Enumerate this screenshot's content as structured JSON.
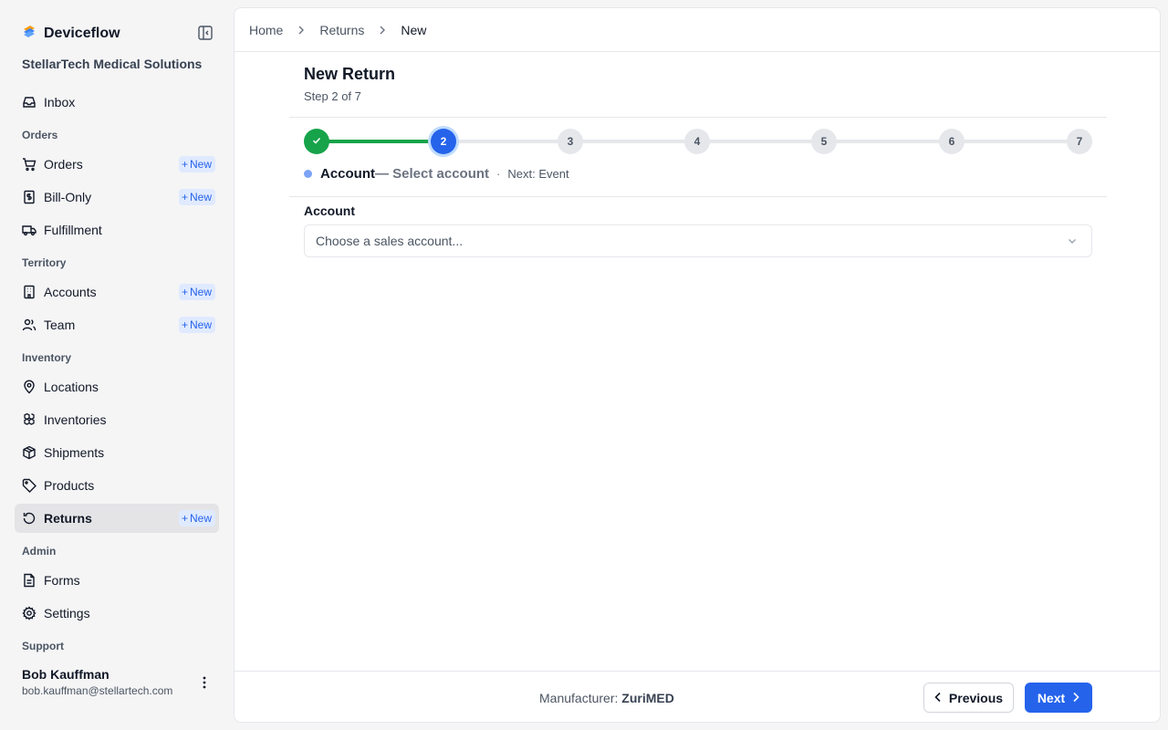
{
  "app": {
    "name": "Deviceflow",
    "org": "StellarTech Medical Solutions"
  },
  "sidebar": {
    "inbox": "Inbox",
    "sections": {
      "orders": "Orders",
      "territory": "Territory",
      "inventory": "Inventory",
      "admin": "Admin",
      "support": "Support"
    },
    "items": {
      "orders": "Orders",
      "bill_only": "Bill-Only",
      "fulfillment": "Fulfillment",
      "accounts": "Accounts",
      "team": "Team",
      "locations": "Locations",
      "inventories": "Inventories",
      "shipments": "Shipments",
      "products": "Products",
      "returns": "Returns",
      "forms": "Forms",
      "settings": "Settings"
    },
    "new_label": "New",
    "active_item": "Returns"
  },
  "user": {
    "name": "Bob Kauffman",
    "email": "bob.kauffman@stellartech.com"
  },
  "breadcrumb": [
    "Home",
    "Returns",
    "New"
  ],
  "page": {
    "title": "New Return",
    "subtitle": "Step 2 of 7"
  },
  "stepper": {
    "total": 7,
    "current": 2,
    "steps": [
      "1",
      "2",
      "3",
      "4",
      "5",
      "6",
      "7"
    ],
    "current_name": "Account",
    "current_desc": "— Select account",
    "separator": "·",
    "next_label": "Next: Event"
  },
  "form": {
    "account_label": "Account",
    "account_placeholder": "Choose a sales account..."
  },
  "footer": {
    "manufacturer_label": "Manufacturer:",
    "manufacturer_value": "ZuriMED",
    "prev_label": "Previous",
    "next_label": "Next"
  },
  "colors": {
    "primary": "#2563eb",
    "success": "#16a34a",
    "badge_bg": "#e0eaff"
  }
}
